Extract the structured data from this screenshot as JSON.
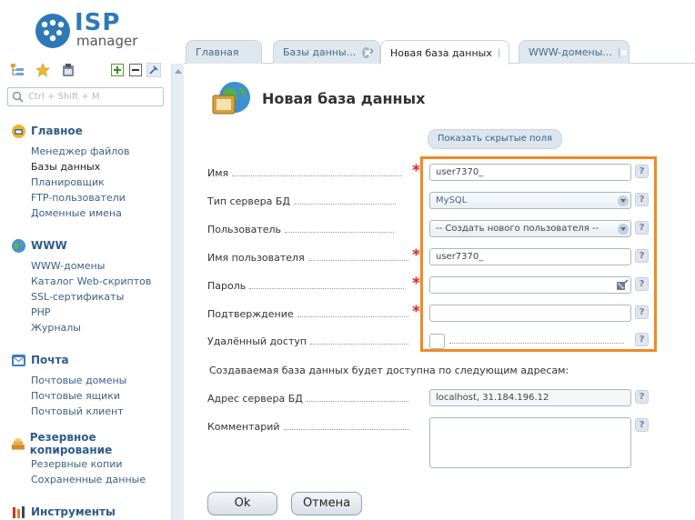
{
  "logo": {
    "brand": "ISP",
    "sub": "manager"
  },
  "search": {
    "placeholder": "Ctrl + Shift + M"
  },
  "sidebar": {
    "groups": [
      {
        "title": "Главное",
        "icon": "home-icon",
        "items": [
          "Менеджер файлов",
          "Базы данных",
          "Планировщик",
          "FTP-пользователи",
          "Доменные имена"
        ]
      },
      {
        "title": "WWW",
        "icon": "globe-icon",
        "items": [
          "WWW-домены",
          "Каталог Web-скриптов",
          "SSL-сертификаты",
          "PHP",
          "Журналы"
        ]
      },
      {
        "title": "Почта",
        "icon": "mail-icon",
        "items": [
          "Почтовые домены",
          "Почтовые ящики",
          "Почтовый клиент"
        ]
      },
      {
        "title": "Резервное копирование",
        "icon": "backup-icon",
        "items": [
          "Резервные копии",
          "Сохраненные данные"
        ]
      },
      {
        "title": "Инструменты",
        "icon": "tools-icon",
        "items": []
      }
    ],
    "active_item": "Базы данных"
  },
  "tabs": [
    {
      "label": "Главная",
      "closable": false
    },
    {
      "label": "Базы данны...",
      "closable": true
    },
    {
      "label": "Новая база данных",
      "closable": true,
      "active": true
    },
    {
      "label": "WWW-домены...",
      "closable": true
    }
  ],
  "page": {
    "title": "Новая база данных"
  },
  "form": {
    "show_hidden": "Показать скрытые поля",
    "fields": {
      "name": {
        "label": "Имя",
        "value": "user7370_",
        "required": true
      },
      "server_type": {
        "label": "Тип сервера БД",
        "value": "MySQL"
      },
      "user": {
        "label": "Пользователь",
        "value": "-- Создать нового пользователя --"
      },
      "username": {
        "label": "Имя пользователя",
        "value": "user7370_",
        "required": true
      },
      "password": {
        "label": "Пароль",
        "value": "",
        "required": true
      },
      "confirm": {
        "label": "Подтверждение",
        "value": "",
        "required": true
      },
      "remote": {
        "label": "Удалённый доступ",
        "checked": false
      },
      "server_address": {
        "label": "Адрес сервера БД",
        "value": "localhost, 31.184.196.12"
      },
      "comment": {
        "label": "Комментарий",
        "value": ""
      }
    },
    "info_text": "Создаваемая база данных будет доступна по следующим адресам:",
    "required_mark": "*",
    "help_mark": "?"
  },
  "buttons": {
    "ok": "Ok",
    "cancel": "Отмена"
  },
  "colors": {
    "highlight": "#f08a24",
    "link": "#3a5f85",
    "brand": "#2f78b8",
    "required": "#dd2222"
  }
}
